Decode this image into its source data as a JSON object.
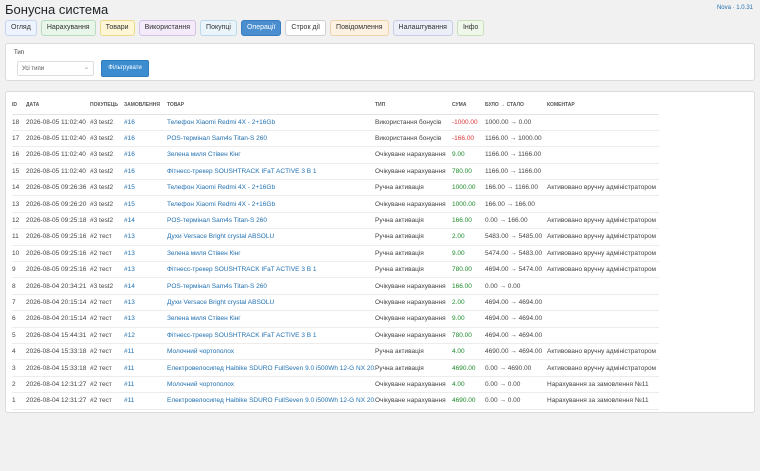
{
  "header": {
    "title": "Бонусна система",
    "version": "Nova · 1.0.31"
  },
  "tabs": [
    {
      "label": "Огляд",
      "bg": "#eef4ff",
      "border": "#c5d6ee",
      "color": "#333"
    },
    {
      "label": "Нарахування",
      "bg": "#e8f6ea",
      "border": "#b7dcbd",
      "color": "#333"
    },
    {
      "label": "Товари",
      "bg": "#fff6d6",
      "border": "#ecd98c",
      "color": "#333"
    },
    {
      "label": "Використання",
      "bg": "#f3eafa",
      "border": "#d6c1e8",
      "color": "#333"
    },
    {
      "label": "Покупці",
      "bg": "#e9f4fb",
      "border": "#bcd9ea",
      "color": "#333"
    },
    {
      "label": "Операції",
      "bg": "#4a8ed0",
      "border": "#3a7bbd",
      "color": "#fff"
    },
    {
      "label": "Строк дії",
      "bg": "#ffffff",
      "border": "#cfcfcf",
      "color": "#333"
    },
    {
      "label": "Повідомлення",
      "bg": "#fdf1e2",
      "border": "#ecd2ad",
      "color": "#333"
    },
    {
      "label": "Налаштування",
      "bg": "#eceef8",
      "border": "#c8cce6",
      "color": "#333"
    },
    {
      "label": "Інфо",
      "bg": "#eef7ea",
      "border": "#c9e0bd",
      "color": "#333"
    }
  ],
  "filter": {
    "label": "Тип",
    "select_value": "Усі типи",
    "button_label": "Фільтрувати"
  },
  "table": {
    "columns": [
      "ID",
      "ДАТА",
      "ПОКУПЕЦЬ",
      "ЗАМОВЛЕННЯ",
      "ТОВАР",
      "ТИП",
      "СУМА",
      "БУЛО → СТАЛО",
      "КОМЕНТАР"
    ],
    "rows": [
      {
        "id": "18",
        "date": "2026-08-05 11:02:40",
        "buyer": "#3 test2",
        "order": "#16",
        "product": "Телефон Xiaomi Redmi 4X - 2+16Gb",
        "type": "Використання бонусів",
        "amount": "-1000.00",
        "change": "1000.00 → 0.00",
        "comment": ""
      },
      {
        "id": "17",
        "date": "2026-08-05 11:02:40",
        "buyer": "#3 test2",
        "order": "#16",
        "product": "POS-термінал Sam4s Titan-S 260",
        "type": "Використання бонусів",
        "amount": "-166.00",
        "change": "1166.00 → 1000.00",
        "comment": ""
      },
      {
        "id": "16",
        "date": "2026-08-05 11:02:40",
        "buyer": "#3 test2",
        "order": "#16",
        "product": "Зелена миля Стівен Кінг",
        "type": "Очікуване нарахування",
        "amount": "9.00",
        "change": "1166.00 → 1166.00",
        "comment": ""
      },
      {
        "id": "15",
        "date": "2026-08-05 11:02:40",
        "buyer": "#3 test2",
        "order": "#16",
        "product": "Фітнесс-трекер SOUSHTRACK IFaT ACTIVE 3 В 1",
        "type": "Очікуване нарахування",
        "amount": "780.00",
        "change": "1166.00 → 1166.00",
        "comment": ""
      },
      {
        "id": "14",
        "date": "2026-08-05 09:26:36",
        "buyer": "#3 test2",
        "order": "#15",
        "product": "Телефон Xiaomi Redmi 4X - 2+16Gb",
        "type": "Ручна активація",
        "amount": "1000.00",
        "change": "166.00 → 1166.00",
        "comment": "Активовано вручну адміністратором"
      },
      {
        "id": "13",
        "date": "2026-08-05 09:26:20",
        "buyer": "#3 test2",
        "order": "#15",
        "product": "Телефон Xiaomi Redmi 4X - 2+16Gb",
        "type": "Очікуване нарахування",
        "amount": "1000.00",
        "change": "166.00 → 166.00",
        "comment": ""
      },
      {
        "id": "12",
        "date": "2026-08-05 09:25:18",
        "buyer": "#3 test2",
        "order": "#14",
        "product": "POS-термінал Sam4s Titan-S 260",
        "type": "Ручна активація",
        "amount": "166.00",
        "change": "0.00 → 166.00",
        "comment": "Активовано вручну адміністратором"
      },
      {
        "id": "11",
        "date": "2026-08-05 09:25:16",
        "buyer": "#2 тест",
        "order": "#13",
        "product": "Духи Versace Bright crystal ABSOLU",
        "type": "Ручна активація",
        "amount": "2.00",
        "change": "5483.00 → 5485.00",
        "comment": "Активовано вручну адміністратором"
      },
      {
        "id": "10",
        "date": "2026-08-05 09:25:16",
        "buyer": "#2 тест",
        "order": "#13",
        "product": "Зелена миля Стівен Кінг",
        "type": "Ручна активація",
        "amount": "9.00",
        "change": "5474.00 → 5483.00",
        "comment": "Активовано вручну адміністратором"
      },
      {
        "id": "9",
        "date": "2026-08-05 09:25:16",
        "buyer": "#2 тест",
        "order": "#13",
        "product": "Фітнесс-трекер SOUSHTRACK IFaT ACTIVE 3 В 1",
        "type": "Ручна активація",
        "amount": "780.00",
        "change": "4694.00 → 5474.00",
        "comment": "Активовано вручну адміністратором"
      },
      {
        "id": "8",
        "date": "2026-08-04 20:34:21",
        "buyer": "#3 test2",
        "order": "#14",
        "product": "POS-термінал Sam4s Titan-S 260",
        "type": "Очікуване нарахування",
        "amount": "166.00",
        "change": "0.00 → 0.00",
        "comment": ""
      },
      {
        "id": "7",
        "date": "2026-08-04 20:15:14",
        "buyer": "#2 тест",
        "order": "#13",
        "product": "Духи Versace Bright crystal ABSOLU",
        "type": "Очікуване нарахування",
        "amount": "2.00",
        "change": "4694.00 → 4694.00",
        "comment": ""
      },
      {
        "id": "6",
        "date": "2026-08-04 20:15:14",
        "buyer": "#2 тест",
        "order": "#13",
        "product": "Зелена миля Стівен Кінг",
        "type": "Очікуване нарахування",
        "amount": "9.00",
        "change": "4694.00 → 4694.00",
        "comment": ""
      },
      {
        "id": "5",
        "date": "2026-08-04 15:44:31",
        "buyer": "#2 тест",
        "order": "#12",
        "product": "Фітнесс-трекер SOUSHTRACK IFaT ACTIVE 3 В 1",
        "type": "Очікуване нарахування",
        "amount": "780.00",
        "change": "4694.00 → 4694.00",
        "comment": ""
      },
      {
        "id": "4",
        "date": "2026-08-04 15:33:18",
        "buyer": "#2 тест",
        "order": "#11",
        "product": "Молочний чортополох",
        "type": "Ручна активація",
        "amount": "4.00",
        "change": "4690.00 → 4694.00",
        "comment": "Активовано вручну адміністратором"
      },
      {
        "id": "3",
        "date": "2026-08-04 15:33:18",
        "buyer": "#2 тест",
        "order": "#11",
        "product": "Електровелосипед Haibike SDURO FullSeven 9.0 i500Wh 12-G NX 2019",
        "type": "Ручна активація",
        "amount": "4690.00",
        "change": "0.00 → 4690.00",
        "comment": "Активовано вручну адміністратором"
      },
      {
        "id": "2",
        "date": "2026-08-04 12:31:27",
        "buyer": "#2 тест",
        "order": "#11",
        "product": "Молочний чортополох",
        "type": "Очікуване нарахування",
        "amount": "4.00",
        "change": "0.00 → 0.00",
        "comment": "Нарахування за замовлення №11"
      },
      {
        "id": "1",
        "date": "2026-08-04 12:31:27",
        "buyer": "#2 тест",
        "order": "#11",
        "product": "Електровелосипед Haibike SDURO FullSeven 9.0 i500Wh 12-G NX 2019",
        "type": "Очікуване нарахування",
        "amount": "4690.00",
        "change": "0.00 → 0.00",
        "comment": "Нарахування за замовлення №11"
      }
    ]
  }
}
